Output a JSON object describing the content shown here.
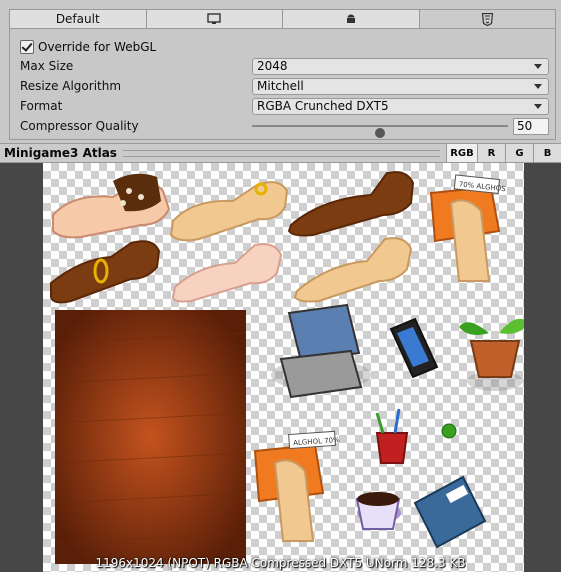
{
  "platform_tabs": [
    {
      "label": "Default",
      "icon": null
    },
    {
      "label": "",
      "icon": "monitor-icon"
    },
    {
      "label": "",
      "icon": "android-icon"
    },
    {
      "label": "",
      "icon": "html5-icon"
    }
  ],
  "settings": {
    "override_label": "Override for WebGL",
    "override_checked": true,
    "max_size_label": "Max Size",
    "max_size_value": "2048",
    "resize_label": "Resize Algorithm",
    "resize_value": "Mitchell",
    "format_label": "Format",
    "format_value": "RGBA Crunched DXT5",
    "quality_label": "Compressor Quality",
    "quality_value": "50",
    "quality_fraction": 0.5
  },
  "preview": {
    "title": "Minigame3 Atlas",
    "channels": [
      "RGB",
      "R",
      "G",
      "B"
    ],
    "info": "1196x1024 (NPOT)  RGBA Compressed DXT5 UNorm  128.3 KB",
    "sign_text_1": "70% ALGHOS",
    "sign_text_2": "ALGHOL 70%"
  },
  "colors": {
    "panel_bg": "#c8c8c8",
    "preview_bg": "#474747",
    "wood": "#8a3a12",
    "skin_light": "#f6c9a8",
    "skin_tan": "#f0c890",
    "skin_brown": "#7a3c10",
    "orange_sign": "#f07a20"
  }
}
